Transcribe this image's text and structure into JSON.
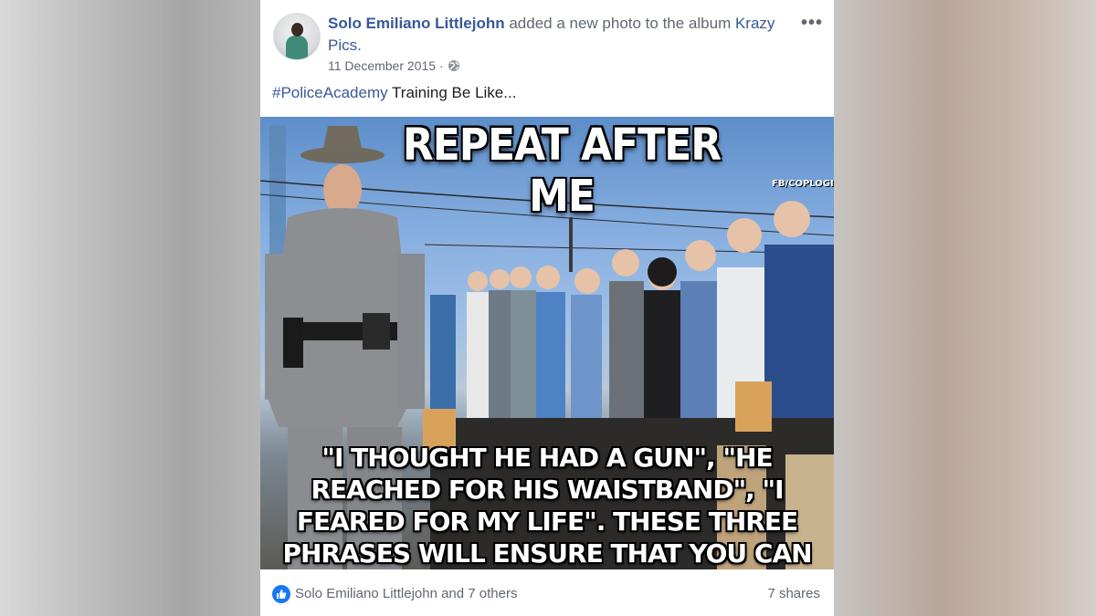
{
  "post": {
    "author": "Solo Emiliano Littlejohn",
    "action_text": " added a new photo to the album ",
    "album": "Krazy Pics.",
    "date": "11 December 2015 ·",
    "privacy_icon": "globe-icon",
    "more_icon": "•••",
    "caption_hashtag": "#PoliceAcademy",
    "caption_text": " Training Be Like...",
    "image": {
      "title": "REPEAT AFTER ME",
      "watermark": "FB/COPLOGIC",
      "body": "\"I THOUGHT HE HAD A GUN\", \"HE REACHED FOR HIS WAISTBAND\", \"I FEARED FOR MY LIFE\". THESE THREE PHRASES WILL ENSURE THAT YOU CAN KILL ANYONE YOU WANT, AND NO JURY WILL CONVICT YOU."
    },
    "reactions_text": "Solo Emiliano Littlejohn and 7 others",
    "shares_text": "7 shares"
  },
  "colors": {
    "link": "#385898",
    "secondary_text": "#606770",
    "like_blue": "#1877f2"
  }
}
